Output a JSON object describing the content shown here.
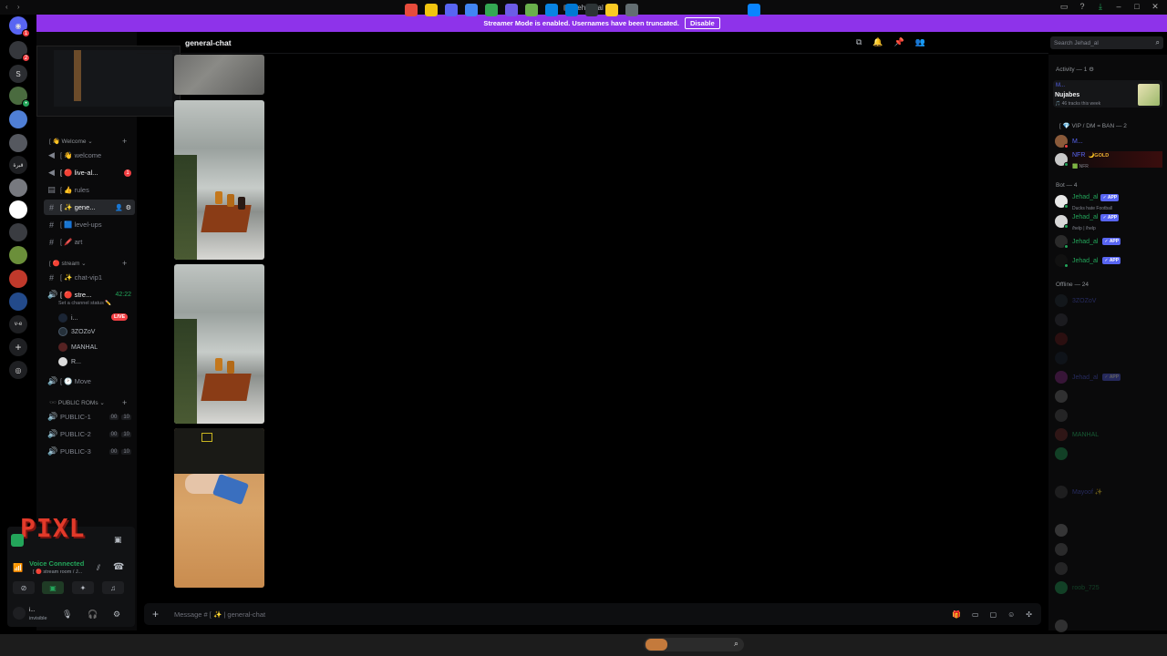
{
  "window": {
    "title": "Jehad_al"
  },
  "banner": {
    "text": "Streamer Mode is enabled. Usernames have been truncated.",
    "button": "Disable"
  },
  "rail": {
    "items": [
      "discord",
      "server-a",
      "S",
      "server-c",
      "server-d",
      "server-e",
      "server-f",
      "server-g",
      "server-h",
      "server-i",
      "server-j",
      "server-k",
      "server-l",
      "v-e",
      "add-server",
      "discover"
    ],
    "labels": {
      "S": "S",
      "ve": "v-e",
      "arabic": "قبرة"
    }
  },
  "channel": {
    "name": "general-chat"
  },
  "search": {
    "placeholder": "Search Jehad_al"
  },
  "categories": {
    "welcome": "[ 👋 Welcome ⌄",
    "stream": "[ 🔴 stream ⌄",
    "public": "🕶️ PUBLIC ROMs ⌄"
  },
  "channels": {
    "welcome": "[ 👋 welcome",
    "live": "[ 🔴 live-al...",
    "rules": "[ 👍 rules",
    "general": "[ ✨ gene...",
    "levelups": "[ 🟦 level-ups",
    "art": "[ 🖍️ art",
    "chatvip": "[ ✨ chat-vip1",
    "stream": "[ 🔴 stre...",
    "stream_time": "42:22",
    "stream_status": "Set a channel status ✏️",
    "move": "[ 🕐 Move",
    "public1": "PUBLIC-1",
    "public2": "PUBLIC-2",
    "public3": "PUBLIC-3",
    "pill_a": "00",
    "pill_b": "10"
  },
  "voice_users": {
    "u1": "i...",
    "u2": "3ZOZoV",
    "u3": "MANHAL",
    "u4": "R...",
    "live": "LIVE"
  },
  "badges": {
    "live_count": "1"
  },
  "user_panel": {
    "logo": "PIXL",
    "voice_title": "Voice Connected",
    "voice_sub": "[ 🔴 stream room / J...",
    "status": "invisible",
    "user_short": "i..."
  },
  "composer": {
    "placeholder": "Message # [ ✨ | general-chat"
  },
  "members": {
    "activity_header": "Activity — 1 ⚙",
    "activity_name": "M...",
    "activity_title": "Nujabes",
    "activity_sub": "🎵 46 tracks this week",
    "vip_header": "[ 💎 VIP / DM = BAN — 2",
    "vip1": "M...",
    "vip2": "NFR",
    "vip2_badge": "🌙GOLD",
    "vip2_sub": "🟩 NFR",
    "bot_header": "Bot — 4",
    "bot_name": "Jehad_al",
    "app": "✓ APP",
    "bot1_sub": "Ducks hate Football",
    "bot2_sub": "/help | /help",
    "offline_header": "Offline — 24",
    "off1": "3ZOZoV",
    "off_manhal": "MANHAL",
    "off_mayoof": "Mayoof ✨",
    "off_roob": "roob_725"
  },
  "colors": {
    "banner": "#8e33ea",
    "online": "#23a55a",
    "app": "#5865f2",
    "danger": "#f23f43"
  }
}
